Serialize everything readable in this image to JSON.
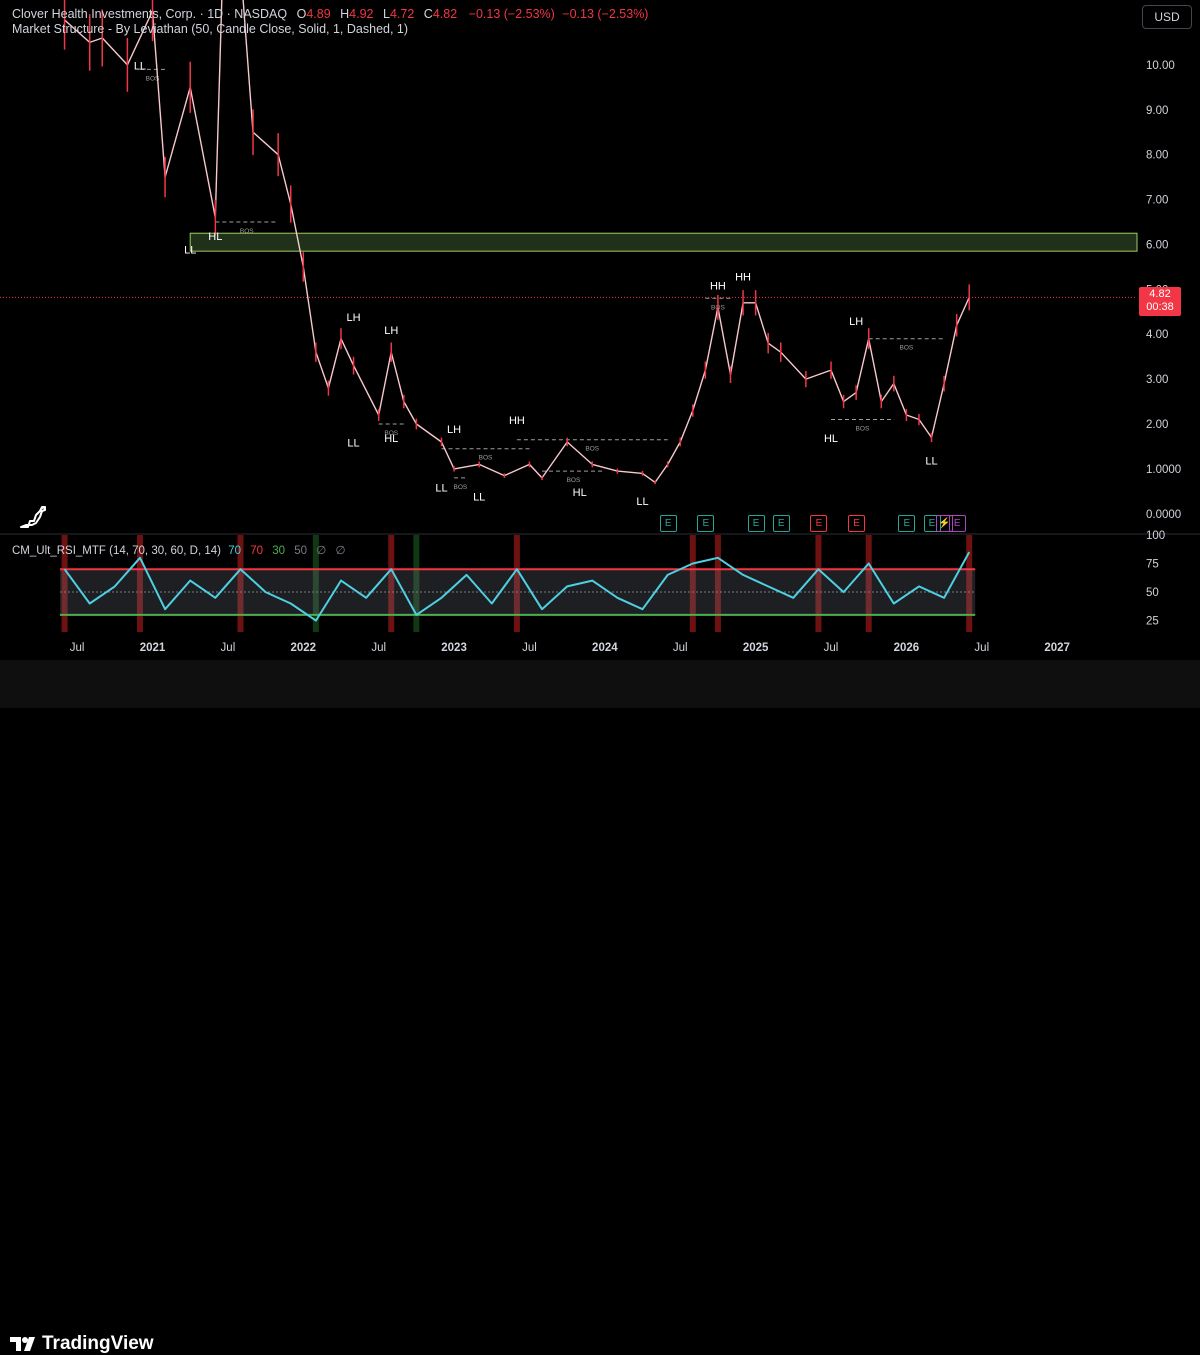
{
  "header": {
    "symbol": "Clover Health Investments, Corp. · 1D · NASDAQ",
    "o_label": "O",
    "o_value": "4.89",
    "h_label": "H",
    "h_value": "4.92",
    "l_label": "L",
    "l_value": "4.72",
    "c_label": "C",
    "c_value": "4.82",
    "change": "−0.13 (−2.53%)",
    "change2": "−0.13 (−2.53%)",
    "indicator": "Market Structure - By Leviathan (50, Candle Close, Solid, 1, Dashed, 1)"
  },
  "currency": "USD",
  "price_tag": {
    "price": "4.82",
    "countdown": "00:38"
  },
  "rsi_legend": {
    "name": "CM_Ult_RSI_MTF (14, 70, 30, 60, D, 14)",
    "v1": "70",
    "v2": "70",
    "v3": "30",
    "v4": "50",
    "v5": "∅",
    "v6": "∅"
  },
  "brand": "TradingView",
  "earnings_label": "E",
  "colors": {
    "up": "#26a69a",
    "down": "#f23645",
    "rsi_line": "#4dd0e1",
    "zone": "#4a7a3a",
    "background": "#000000",
    "bull_bg": "#1b5e20",
    "bear_bg": "#b71c1c"
  },
  "chart_data": [
    {
      "type": "candlestick",
      "title": "Clover Health Investments, Corp. · 1D · NASDAQ",
      "y_ticks": [
        "0.0000",
        "1.0000",
        "2.00",
        "3.00",
        "4.00",
        "5.00",
        "6.00",
        "7.00",
        "8.00",
        "9.00",
        "10.00"
      ],
      "y_range": [
        -0.25,
        11
      ],
      "x_ticks": [
        "Jul",
        "2021",
        "Jul",
        "2022",
        "Jul",
        "2023",
        "Jul",
        "2024",
        "Jul",
        "2025",
        "Jul",
        "2026",
        "Jul",
        "2027"
      ],
      "x_range": [
        "2020-05",
        "2027-06"
      ],
      "last_price": 4.82,
      "series": [
        {
          "x": [
            "2020-06",
            "2020-08",
            "2020-09",
            "2020-11",
            "2021-01",
            "2021-02",
            "2021-04",
            "2021-06",
            "2021-07",
            "2021-09",
            "2021-11",
            "2021-12",
            "2022-01",
            "2022-02",
            "2022-03",
            "2022-04",
            "2022-05",
            "2022-07",
            "2022-08",
            "2022-09",
            "2022-10",
            "2022-12",
            "2023-01",
            "2023-03",
            "2023-05",
            "2023-07",
            "2023-08",
            "2023-10",
            "2023-12",
            "2024-02",
            "2024-04",
            "2024-05",
            "2024-06",
            "2024-07",
            "2024-08",
            "2024-09",
            "2024-10",
            "2024-11",
            "2024-12",
            "2025-01",
            "2025-02",
            "2025-03",
            "2025-05",
            "2025-07",
            "2025-08",
            "2025-09",
            "2025-10",
            "2025-11",
            "2025-12",
            "2026-01",
            "2026-02",
            "2026-03",
            "2026-04",
            "2026-05",
            "2026-06"
          ],
          "y": [
            11.0,
            10.5,
            10.6,
            10.0,
            11.2,
            7.5,
            9.5,
            6.6,
            16.0,
            8.5,
            8.0,
            6.9,
            5.5,
            3.6,
            2.8,
            3.9,
            3.3,
            2.2,
            3.6,
            2.5,
            2.0,
            1.6,
            1.0,
            1.1,
            0.85,
            1.1,
            0.8,
            1.6,
            1.1,
            0.95,
            0.9,
            0.7,
            1.1,
            1.6,
            2.3,
            3.2,
            4.6,
            3.1,
            4.7,
            4.7,
            3.8,
            3.6,
            3.0,
            3.2,
            2.5,
            2.7,
            3.9,
            2.5,
            2.9,
            2.2,
            2.1,
            1.7,
            2.9,
            4.2,
            4.82
          ]
        }
      ],
      "structure_labels": [
        {
          "text": "LL",
          "x": "2020-12",
          "y": 9.9
        },
        {
          "text": "LL",
          "x": "2021-04",
          "y": 5.8
        },
        {
          "text": "HL",
          "x": "2021-06",
          "y": 6.1
        },
        {
          "text": "LH",
          "x": "2022-05",
          "y": 4.3
        },
        {
          "text": "LL",
          "x": "2022-05",
          "y": 1.5
        },
        {
          "text": "LH",
          "x": "2022-08",
          "y": 4.0
        },
        {
          "text": "HL",
          "x": "2022-08",
          "y": 1.6
        },
        {
          "text": "LH",
          "x": "2023-01",
          "y": 1.8
        },
        {
          "text": "LL",
          "x": "2022-12",
          "y": 0.5
        },
        {
          "text": "HH",
          "x": "2023-06",
          "y": 2.0
        },
        {
          "text": "LL",
          "x": "2023-03",
          "y": 0.3
        },
        {
          "text": "HL",
          "x": "2023-11",
          "y": 0.4
        },
        {
          "text": "LL",
          "x": "2024-04",
          "y": 0.2
        },
        {
          "text": "HH",
          "x": "2024-10",
          "y": 5.0
        },
        {
          "text": "HH",
          "x": "2024-12",
          "y": 5.2
        },
        {
          "text": "LH",
          "x": "2025-09",
          "y": 4.2
        },
        {
          "text": "HL",
          "x": "2025-07",
          "y": 1.6
        },
        {
          "text": "LL",
          "x": "2026-03",
          "y": 1.1
        }
      ],
      "bos_label": "BOS",
      "bos_lines": [
        {
          "y": 9.9,
          "from": "2020-12",
          "to": "2021-02"
        },
        {
          "y": 6.5,
          "from": "2021-06",
          "to": "2021-11"
        },
        {
          "y": 2.0,
          "from": "2022-07",
          "to": "2022-09"
        },
        {
          "y": 1.45,
          "from": "2022-12",
          "to": "2023-07"
        },
        {
          "y": 1.65,
          "from": "2023-06",
          "to": "2024-06"
        },
        {
          "y": 0.95,
          "from": "2023-08",
          "to": "2024-01"
        },
        {
          "y": 0.8,
          "from": "2023-01",
          "to": "2023-02"
        },
        {
          "y": 4.8,
          "from": "2024-09",
          "to": "2024-11"
        },
        {
          "y": 3.9,
          "from": "2025-10",
          "to": "2026-04"
        },
        {
          "y": 2.1,
          "from": "2025-07",
          "to": "2025-12"
        }
      ],
      "zone": {
        "from": "2021-04",
        "to": "2027-06",
        "y_low": 5.85,
        "y_high": 6.25
      },
      "earnings": [
        {
          "x": "2024-06",
          "kind": "up"
        },
        {
          "x": "2024-09",
          "kind": "up"
        },
        {
          "x": "2025-01",
          "kind": "up"
        },
        {
          "x": "2025-03",
          "kind": "up"
        },
        {
          "x": "2025-06",
          "kind": "down"
        },
        {
          "x": "2025-09",
          "kind": "down"
        },
        {
          "x": "2026-01",
          "kind": "up"
        },
        {
          "x": "2026-03",
          "kind": "up"
        },
        {
          "x": "2026-04",
          "kind": "dividend"
        },
        {
          "x": "2026-05",
          "kind": "purple"
        }
      ]
    },
    {
      "type": "line",
      "title": "CM_Ult_RSI_MTF (14, 70, 30, 60, D, 14)",
      "y_ticks": [
        "25",
        "50",
        "75",
        "100"
      ],
      "y_range": [
        15,
        100
      ],
      "upper_band": 70,
      "lower_band": 30,
      "series": [
        {
          "x": [
            "2020-06",
            "2020-08",
            "2020-10",
            "2020-12",
            "2021-02",
            "2021-04",
            "2021-06",
            "2021-08",
            "2021-10",
            "2021-12",
            "2022-02",
            "2022-04",
            "2022-06",
            "2022-08",
            "2022-10",
            "2022-12",
            "2023-02",
            "2023-04",
            "2023-06",
            "2023-08",
            "2023-10",
            "2023-12",
            "2024-02",
            "2024-04",
            "2024-06",
            "2024-08",
            "2024-10",
            "2024-12",
            "2025-02",
            "2025-04",
            "2025-06",
            "2025-08",
            "2025-10",
            "2025-12",
            "2026-02",
            "2026-04",
            "2026-06"
          ],
          "y": [
            70,
            40,
            55,
            80,
            35,
            60,
            45,
            70,
            50,
            40,
            25,
            60,
            45,
            70,
            30,
            45,
            65,
            40,
            70,
            35,
            55,
            60,
            45,
            35,
            65,
            75,
            80,
            65,
            55,
            45,
            70,
            50,
            75,
            40,
            55,
            45,
            85
          ]
        }
      ]
    }
  ]
}
